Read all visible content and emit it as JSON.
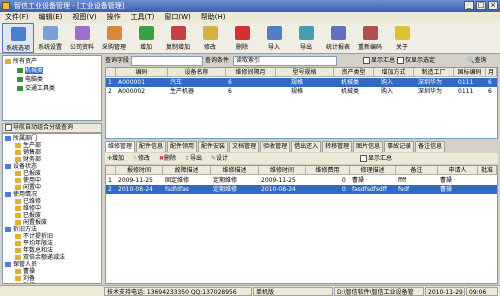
{
  "window": {
    "title": "智信工业设备管理 - [工业设备管理]"
  },
  "menu": [
    "文件(F)",
    "编辑(E)",
    "视图(V)",
    "操作",
    "工具(T)",
    "窗口(W)",
    "帮助(H)"
  ],
  "toolbar": [
    "系统选项",
    "系统设置",
    "公司资料",
    "采购管理",
    "增加",
    "复制增加",
    "修改",
    "删除",
    "导入",
    "导出",
    "统计报表",
    "重新编码",
    "关于"
  ],
  "tree_top": {
    "items": [
      "所有资产",
      "机械类",
      "电脑类",
      "交通工具类"
    ]
  },
  "nav_panel": {
    "title": "导航自动组合分级查询",
    "items": [
      "所属部门",
      "生产部",
      "销售部",
      "财务部",
      "设备状态",
      "已报废",
      "使用中",
      "闲置中",
      "使用情况",
      "已维修",
      "维修中",
      "已报废",
      "闲置报废",
      "折旧方法",
      "不计提折旧",
      "平均年限法",
      "年数总和法",
      "双倍余额递减法",
      "保管人员",
      "曹操",
      "刘备",
      "孙权"
    ]
  },
  "query": {
    "field_label": "查询字段",
    "condition_label": "查询条件",
    "condition_value": "读取索引",
    "show_summary": "显示汇总",
    "show_selected": "仅显示选定",
    "search_btn": "查询"
  },
  "main_table": {
    "columns": [
      "编码",
      "设备名称",
      "维修间隔月",
      "型号规格",
      "资产类型",
      "增加方式",
      "制造工厂",
      "国标编码",
      "月"
    ],
    "rows": [
      {
        "num": "1",
        "cells": [
          "A000001",
          "汽车",
          "6",
          "规格",
          "机械类",
          "购入",
          "深圳华为",
          "0111",
          "6"
        ]
      },
      {
        "num": "2",
        "cells": [
          "A000002",
          "生产机器",
          "6",
          "规格",
          "机械类",
          "购入",
          "深圳华为",
          "0111",
          "6"
        ]
      }
    ]
  },
  "sub_tabs": [
    "维修管理",
    "配件信息",
    "配件领用",
    "配件安装",
    "文档管理",
    "验收管理",
    "借出还入",
    "转移管理",
    "图片信息",
    "事故记录",
    "备注信息"
  ],
  "sub_toolbar": [
    "增加",
    "修改",
    "删除",
    "导出",
    "设计"
  ],
  "sub_show_summary": "显示汇总",
  "sub_table": {
    "columns": [
      "报修时间",
      "故障描述",
      "维修描述",
      "维修时间",
      "维修费用",
      "修理描述",
      "备注",
      "申请人",
      "批准"
    ],
    "rows": [
      {
        "num": "1",
        "cells": [
          "2009-11-25",
          "固定维修",
          "定期维修",
          "2009-11-25",
          "0",
          "曹操",
          "ffff",
          "曹操",
          ""
        ]
      },
      {
        "num": "2",
        "cells": [
          "2010-08-24",
          "fsdfdfas",
          "定期维修",
          "2010-08-24",
          "0",
          "fasdfsdfsdff",
          "fsdf",
          "曹操",
          ""
        ]
      }
    ]
  },
  "status": {
    "support": "技术支持电话: 13694233350 QQ:137028956",
    "mode": "单机版",
    "path": "D:\\智信软件\\智信工业设备管",
    "date": "2010-11-29",
    "time": "09:06"
  },
  "colors": {
    "accent": "#316ac5",
    "title": "#3b5fae"
  }
}
